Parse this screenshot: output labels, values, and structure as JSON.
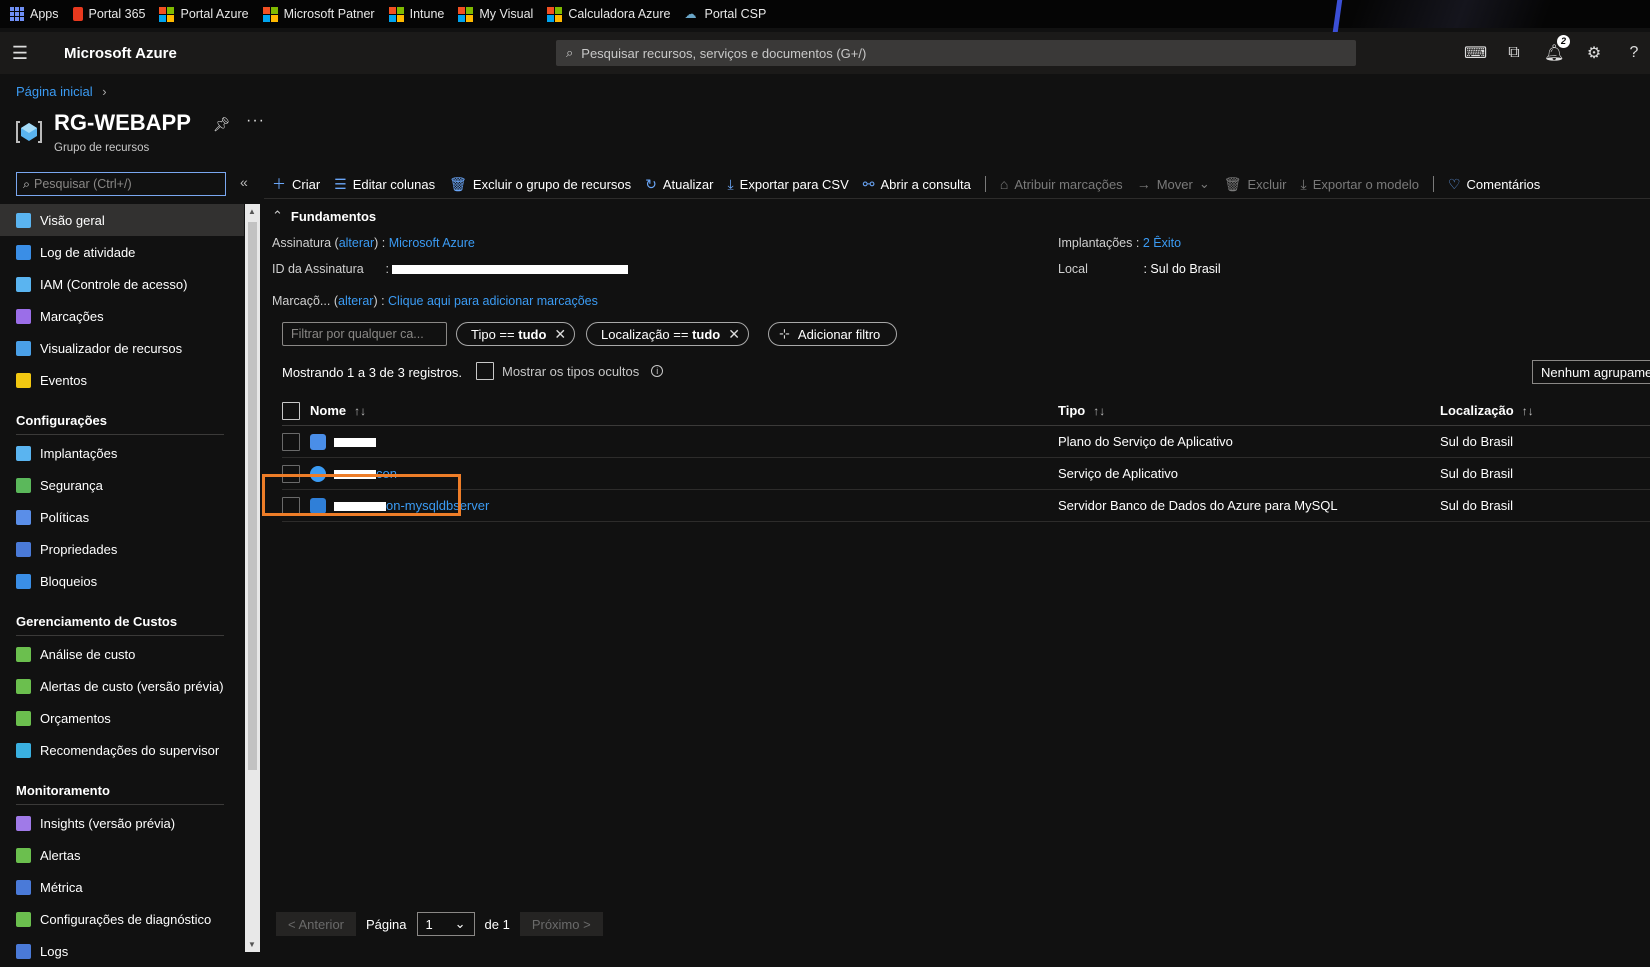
{
  "bookmarks": [
    {
      "label": "Apps"
    },
    {
      "label": "Portal 365"
    },
    {
      "label": "Portal Azure"
    },
    {
      "label": "Microsoft Patner"
    },
    {
      "label": "Intune"
    },
    {
      "label": "My Visual"
    },
    {
      "label": "Calculadora Azure"
    },
    {
      "label": "Portal CSP"
    }
  ],
  "topnav": {
    "brand": "Microsoft Azure",
    "search_placeholder": "Pesquisar recursos, serviços e documentos (G+/)",
    "notification_count": "2"
  },
  "header": {
    "breadcrumb": "Página inicial",
    "title": "RG-WEBAPP",
    "subtitle": "Grupo de recursos"
  },
  "sidebar": {
    "search_placeholder": "Pesquisar (Ctrl+/)",
    "items_top": [
      {
        "label": "Visão geral",
        "color": "#5ab4f0"
      },
      {
        "label": "Log de atividade",
        "color": "#3a8ee6"
      },
      {
        "label": "IAM (Controle de acesso)",
        "color": "#5ab4f0"
      },
      {
        "label": "Marcações",
        "color": "#9b6ee8"
      },
      {
        "label": "Visualizador de recursos",
        "color": "#4aa0e8"
      },
      {
        "label": "Eventos",
        "color": "#f2c811"
      }
    ],
    "section_config": "Configurações",
    "items_config": [
      {
        "label": "Implantações",
        "color": "#5ab4f0"
      },
      {
        "label": "Segurança",
        "color": "#5bb85b"
      },
      {
        "label": "Políticas",
        "color": "#5a8ee8"
      },
      {
        "label": "Propriedades",
        "color": "#4a7ad8"
      },
      {
        "label": "Bloqueios",
        "color": "#3a8ee6"
      }
    ],
    "section_cost": "Gerenciamento de Custos",
    "items_cost": [
      {
        "label": "Análise de custo",
        "color": "#6bbf4e"
      },
      {
        "label": "Alertas de custo (versão prévia)",
        "color": "#6bbf4e"
      },
      {
        "label": "Orçamentos",
        "color": "#6bbf4e"
      },
      {
        "label": "Recomendações do supervisor",
        "color": "#3ab0e0"
      }
    ],
    "section_monitor": "Monitoramento",
    "items_monitor": [
      {
        "label": "Insights (versão prévia)",
        "color": "#a07ae8"
      },
      {
        "label": "Alertas",
        "color": "#6bbf4e"
      },
      {
        "label": "Métrica",
        "color": "#4a7ad8"
      },
      {
        "label": "Configurações de diagnóstico",
        "color": "#6bbf4e"
      },
      {
        "label": "Logs",
        "color": "#4a7ad8"
      }
    ]
  },
  "toolbar": {
    "create": "Criar",
    "edit_columns": "Editar colunas",
    "delete_group": "Excluir o grupo de recursos",
    "refresh": "Atualizar",
    "export_csv": "Exportar para CSV",
    "open_query": "Abrir a consulta",
    "assign_tags": "Atribuir marcações",
    "move": "Mover",
    "delete": "Excluir",
    "export_template": "Exportar o modelo",
    "feedback": "Comentários"
  },
  "essentials": {
    "title": "Fundamentos",
    "subscription_label": "Assinatura (",
    "change": "alterar",
    "subscription_label_end": ") :",
    "subscription_value": "Microsoft Azure",
    "subscription_id_label": "ID da Assinatura",
    "colon": ":",
    "tags_label": "Marcaçõ... (",
    "tags_value": "Clique aqui para adicionar marcações",
    "deployments_label": "Implantações",
    "deployments_value": "2 Êxito",
    "location_label": "Local",
    "location_value": ": Sul do Brasil"
  },
  "filters": {
    "placeholder": "Filtrar por qualquer ca...",
    "type_filter_label": "Tipo ==",
    "type_filter_value": "tudo",
    "location_filter_label": "Localização ==",
    "location_filter_value": "tudo",
    "add_filter": "Adicionar filtro"
  },
  "listing": {
    "showing": "Mostrando 1 a 3 de 3 registros.",
    "show_hidden": "Mostrar os tipos ocultos",
    "grouping": "Nenhum agrupamento"
  },
  "table": {
    "columns": {
      "name": "Nome",
      "type": "Tipo",
      "location": "Localização"
    },
    "rows": [
      {
        "name_suffix": "",
        "type": "Plano do Serviço de Aplicativo",
        "location": "Sul do Brasil",
        "icon_color": "#4a8ee8"
      },
      {
        "name_suffix": "con",
        "type": "Serviço de Aplicativo",
        "location": "Sul do Brasil",
        "icon_color": "#3b9bf3"
      },
      {
        "name_suffix": "on-mysqldbserver",
        "type": "Servidor Banco de Dados do Azure para MySQL",
        "location": "Sul do Brasil",
        "icon_color": "#2f7fd8"
      }
    ]
  },
  "pager": {
    "prev": "< Anterior",
    "page_label": "Página",
    "page_value": "1",
    "of": "de 1",
    "next": "Próximo >"
  }
}
